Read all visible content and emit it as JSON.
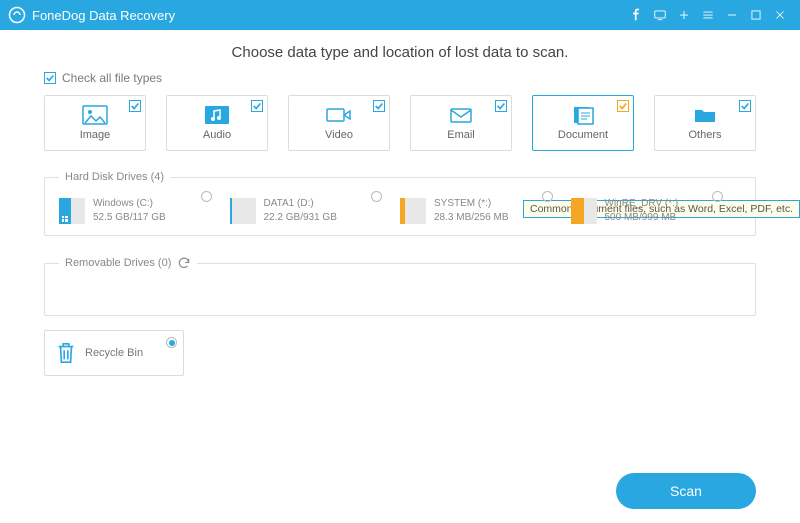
{
  "app": {
    "title": "FoneDog Data Recovery"
  },
  "heading": "Choose data type and location of lost data to scan.",
  "check_all_label": "Check all file types",
  "file_types": [
    {
      "label": "Image"
    },
    {
      "label": "Audio"
    },
    {
      "label": "Video"
    },
    {
      "label": "Email"
    },
    {
      "label": "Document"
    },
    {
      "label": "Others"
    }
  ],
  "tooltip": "Common document files, such as Word, Excel, PDF, etc.",
  "sections": {
    "hard_disk": "Hard Disk Drives (4)",
    "removable": "Removable Drives (0)"
  },
  "drives": [
    {
      "name": "Windows (C:)",
      "size": "52.5 GB/117 GB",
      "color": "blue",
      "used_pct": 45,
      "has_os": true
    },
    {
      "name": "DATA1 (D:)",
      "size": "22.2 GB/931 GB",
      "color": "blue",
      "used_pct": 8,
      "has_os": false
    },
    {
      "name": "SYSTEM (*:)",
      "size": "28.3 MB/256 MB",
      "color": "orange",
      "used_pct": 20,
      "has_os": false
    },
    {
      "name": "WinRE_DRV (*:)",
      "size": "500 MB/999 MB",
      "color": "orange",
      "used_pct": 50,
      "has_os": false
    }
  ],
  "recycle_bin": "Recycle Bin",
  "scan_button": "Scan"
}
